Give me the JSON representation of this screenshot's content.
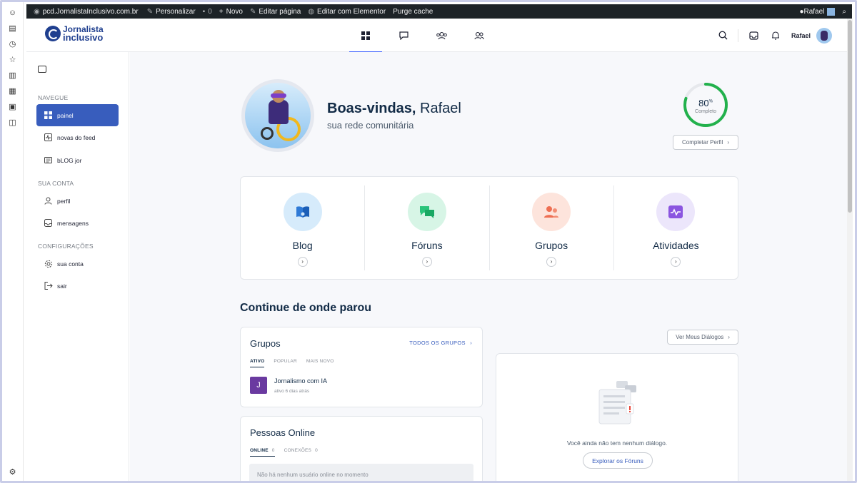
{
  "admin_bar": {
    "site": "pcd.JornalistaInclusivo.com.br",
    "customize": "Personalizar",
    "comments_count": "0",
    "new": "Novo",
    "edit_page": "Editar página",
    "edit_elementor": "Editar com Elementor",
    "purge_cache": "Purge cache",
    "user": "Rafael"
  },
  "header": {
    "logo_line1": "Jornalista",
    "logo_line2": "inclusivo",
    "username": "Rafael"
  },
  "sidebar": {
    "section_navigate": "NAVEGUE",
    "items_navigate": [
      "painel",
      "novas do feed",
      "bLOG jor"
    ],
    "section_account": "SUA CONTA",
    "items_account": [
      "perfil",
      "mensagens"
    ],
    "section_settings": "CONFIGURAÇÕES",
    "items_settings": [
      "sua conta",
      "sair"
    ]
  },
  "profile": {
    "greeting_bold": "Boas-vindas,",
    "name": "Rafael",
    "subtitle": "sua rede comunitária",
    "progress_value": "80",
    "progress_unit": "%",
    "progress_label": "Completo",
    "progress_fraction": 0.8,
    "complete_button": "Completar Perfil"
  },
  "shortcuts": [
    {
      "label": "Blog",
      "color": "#d6ebfb",
      "icon": "book-icon"
    },
    {
      "label": "Fóruns",
      "color": "#d7f5e6",
      "icon": "chat-bubbles-icon"
    },
    {
      "label": "Grupos",
      "color": "#fde4dc",
      "icon": "group-icon"
    },
    {
      "label": "Atividades",
      "color": "#ece6fb",
      "icon": "activity-icon"
    }
  ],
  "continue": {
    "title": "Continue de onde parou"
  },
  "groups_panel": {
    "title": "Grupos",
    "link": "TODOS OS GRUPOS",
    "tabs": [
      "ATIVO",
      "POPULAR",
      "MAIS NOVO"
    ],
    "group_initial": "J",
    "group_name": "Jornalismo com IA",
    "group_meta": "ativo 6 dias atrás"
  },
  "online_panel": {
    "title": "Pessoas Online",
    "tab_online": "ONLINE",
    "tab_online_count": "0",
    "tab_connections": "CONEXÕES",
    "tab_connections_count": "0",
    "empty": "Não há nenhum usuário online no momento"
  },
  "dialogs": {
    "button": "Ver Meus Diálogos",
    "empty": "Você ainda não tem nenhum diálogo.",
    "explore": "Explorar os Fóruns"
  },
  "colors": {
    "accent": "#385dbd",
    "progress": "#22b14c"
  }
}
